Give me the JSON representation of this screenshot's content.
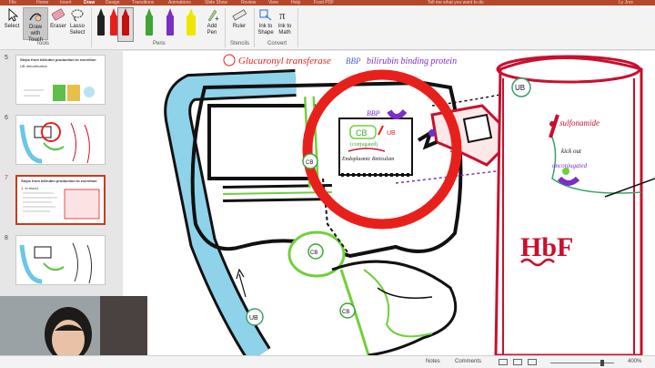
{
  "tabs": [
    "File",
    "Home",
    "Insert",
    "Draw",
    "Design",
    "Transitions",
    "Animations",
    "Slide Show",
    "Review",
    "View",
    "Help",
    "Foxit PDF"
  ],
  "tell_me": "Tell me what you want to do",
  "user": "Ly Jnrs",
  "ribbon": {
    "tools": {
      "select": "Select",
      "draw_touch": "Draw with Touch",
      "eraser": "Eraser",
      "lasso": "Lasso Select",
      "group_label": "Tools"
    },
    "pens": {
      "colors": [
        "#000000",
        "#e8201c",
        "#c41010",
        "#3fa535",
        "#7a2ec7",
        "#f0e600"
      ],
      "add_pen": "Add Pen",
      "group_label": "Pens"
    },
    "stencils": {
      "ruler": "Ruler",
      "group_label": "Stencils"
    },
    "convert": {
      "ink_shape": "Ink to Shape",
      "ink_math": "Ink to Math",
      "group_label": "Convert"
    }
  },
  "thumbnails": [
    {
      "num": "5",
      "title": "Steps from bilirubin production to excretion",
      "sub": "UB detoxification"
    },
    {
      "num": "6",
      "title": "",
      "sub": ""
    },
    {
      "num": "7",
      "title": "Steps from bilirubin production to excretion",
      "sub": "1. In blood"
    },
    {
      "num": "8",
      "title": "",
      "sub": ""
    }
  ],
  "slide": {
    "header_red": "Glucuronyl transferase",
    "header_blue": "BBP",
    "header_purple": "bilirubin binding protein",
    "label_ub_top": "UB",
    "label_bbp": "BBP",
    "label_ub_inner": "UB",
    "label_cb_inner": "CB",
    "label_conjugated": "(conjugated)",
    "label_er": "Endoplasmic Reticulum",
    "label_cb_left": "CB",
    "label_cb_duct": "CB",
    "label_cb_lower": "CB",
    "label_ub_vessel": "UB",
    "label_sulfonamide": "sulfonamide",
    "label_kick_out": "kick out",
    "label_unconjugated": "unconjugated",
    "label_hbf": "HbF"
  },
  "status": {
    "slide_info": "",
    "notes": "Notes",
    "comments": "Comments",
    "zoom": "400%"
  },
  "colors": {
    "accent": "#b7472a",
    "ring_red": "#e8201c",
    "vessel_blue": "#8fd3ea",
    "duct_green": "#6fd13a",
    "purple": "#7a2ec7",
    "intestine_red": "#c8102e"
  }
}
